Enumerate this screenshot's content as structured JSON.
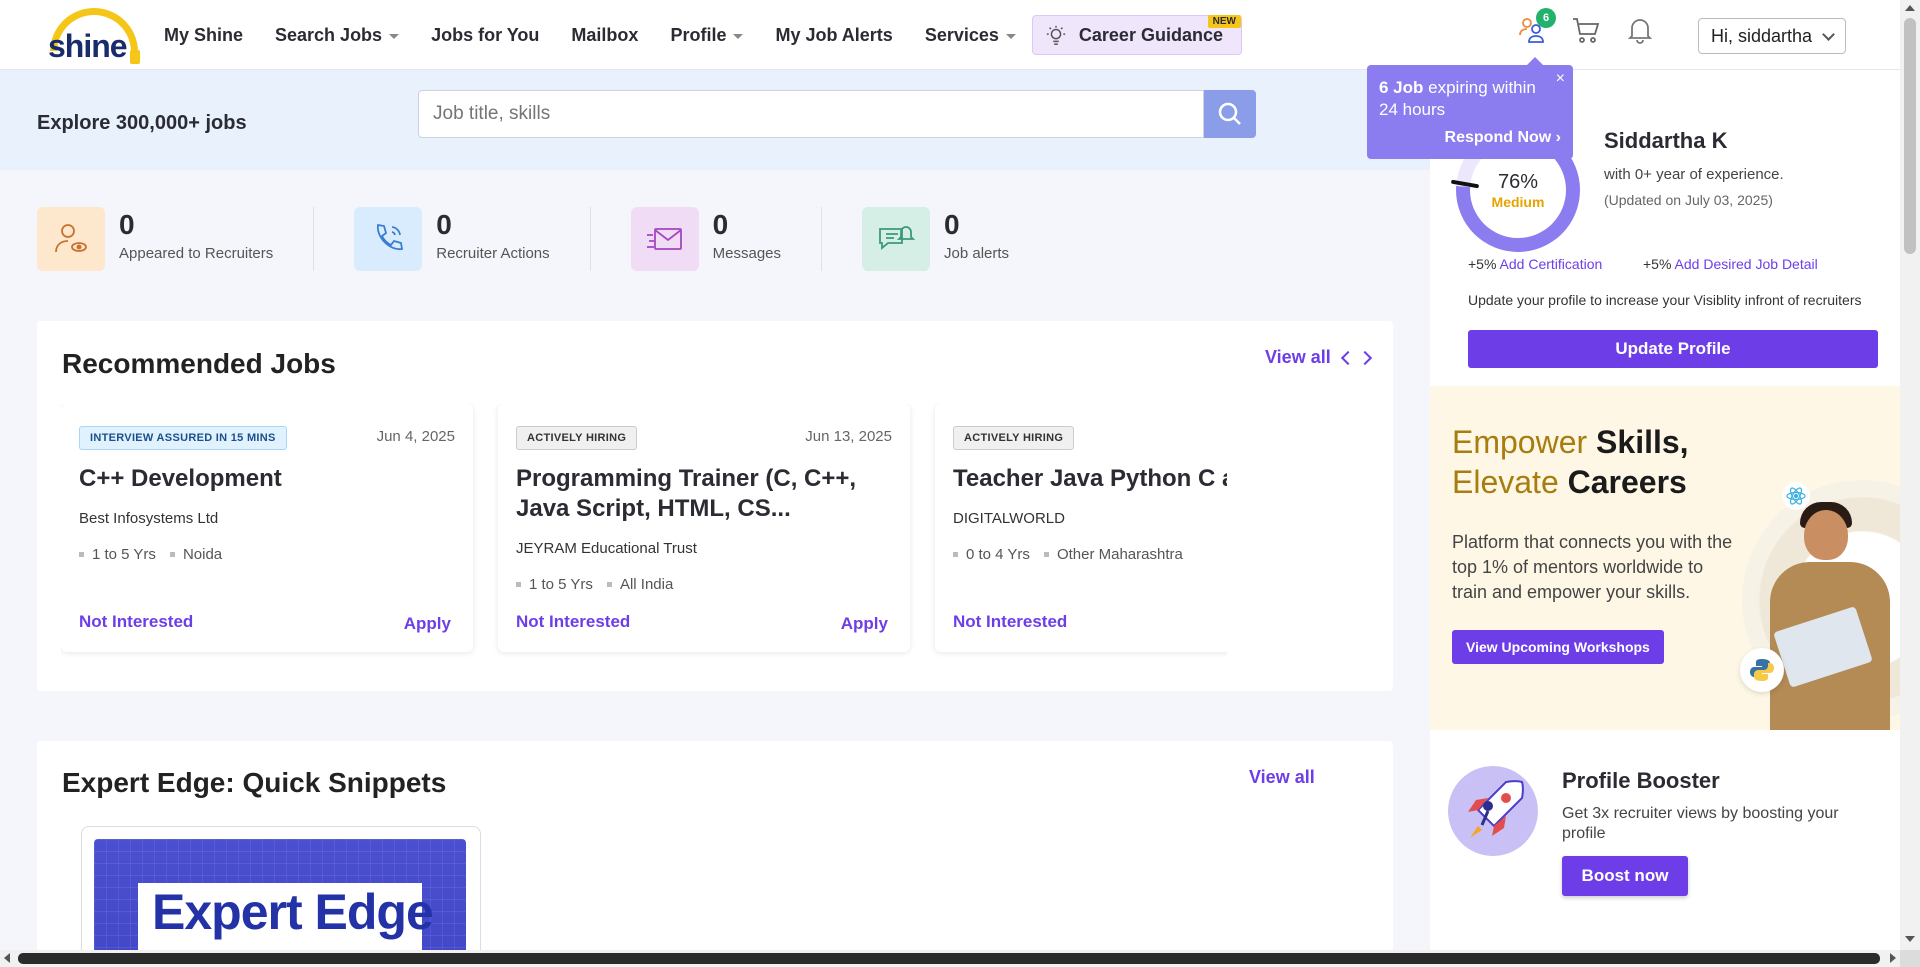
{
  "header": {
    "logo_text": "shine",
    "nav": [
      {
        "label": "My Shine",
        "dropdown": false
      },
      {
        "label": "Search Jobs",
        "dropdown": true
      },
      {
        "label": "Jobs for You",
        "dropdown": false
      },
      {
        "label": "Mailbox",
        "dropdown": false
      },
      {
        "label": "Profile",
        "dropdown": true
      },
      {
        "label": "My Job Alerts",
        "dropdown": false
      },
      {
        "label": "Services",
        "dropdown": true
      }
    ],
    "career_guidance": {
      "label": "Career Guidance",
      "badge": "NEW"
    },
    "notification_count": "6",
    "user_greeting": "Hi, siddartha"
  },
  "search": {
    "explore_text": "Explore 300,000+ jobs",
    "placeholder": "Job title, skills"
  },
  "stats": [
    {
      "value": "0",
      "label": "Appeared to Recruiters",
      "icon": "person-eye-icon",
      "bg": "#fde7cd"
    },
    {
      "value": "0",
      "label": "Recruiter Actions",
      "icon": "phone-icon",
      "bg": "#d9ecfd"
    },
    {
      "value": "0",
      "label": "Messages",
      "icon": "mail-icon",
      "bg": "#f1dcf6"
    },
    {
      "value": "0",
      "label": "Job alerts",
      "icon": "alert-chat-icon",
      "bg": "#d6efe6"
    }
  ],
  "recommended": {
    "title": "Recommended Jobs",
    "view_all": "View all",
    "jobs": [
      {
        "tag": "INTERVIEW ASSURED IN 15 MINS",
        "date": "Jun 4, 2025",
        "title": "C++ Development",
        "company": "Best Infosystems Ltd",
        "experience": "1 to 5 Yrs",
        "location": "Noida",
        "not_interested": "Not Interested",
        "apply": "Apply"
      },
      {
        "tag": "ACTIVELY HIRING",
        "date": "Jun 13, 2025",
        "title": "Programming Trainer (C, C++, Java Script, HTML, CS...",
        "company": "JEYRAM Educational Trust",
        "experience": "1 to 5 Yrs",
        "location": "All India",
        "not_interested": "Not Interested",
        "apply": "Apply"
      },
      {
        "tag": "ACTIVELY HIRING",
        "date": "",
        "title": "Teacher Java Python C and",
        "company": "DIGITALWORLD",
        "experience": "0 to 4 Yrs",
        "location": "Other Maharashtra",
        "not_interested": "Not Interested",
        "apply": ""
      }
    ]
  },
  "expert_edge": {
    "title": "Expert Edge: Quick Snippets",
    "view_all": "View all",
    "thumb_text": "Expert Edge"
  },
  "tooltip": {
    "count_text": "6 Job",
    "rest_text": " expiring within 24 hours",
    "action": "Respond Now",
    "close": "×"
  },
  "profile": {
    "completion": "76%",
    "completion_value": 76,
    "level": "Medium",
    "name": "Siddartha K",
    "experience": "with 0+ year of experience.",
    "updated": "(Updated on July 03, 2025)",
    "add1_pct": "+5%",
    "add1_link": "Add Certification",
    "add2_pct": "+5%",
    "add2_link": "Add Desired Job Detail",
    "note": "Update your profile to increase your Visiblity infront of recruiters",
    "update_btn": "Update Profile"
  },
  "promo": {
    "line1_light": "Empower ",
    "line1_bold": "Skills,",
    "line2_light": "Elevate ",
    "line2_bold": "Careers",
    "description": "Platform that connects you with the top 1% of mentors worldwide to train and empower your skills.",
    "button": "View Upcoming Workshops"
  },
  "booster": {
    "title": "Profile Booster",
    "description": "Get 3x recruiter views by boosting your profile",
    "button": "Boost now"
  },
  "colors": {
    "accent": "#6d3ee8",
    "tooltip": "#8b7cf0",
    "search_band": "#e8f1fc",
    "badge_green": "#23b26d",
    "gold": "#f5c518"
  }
}
